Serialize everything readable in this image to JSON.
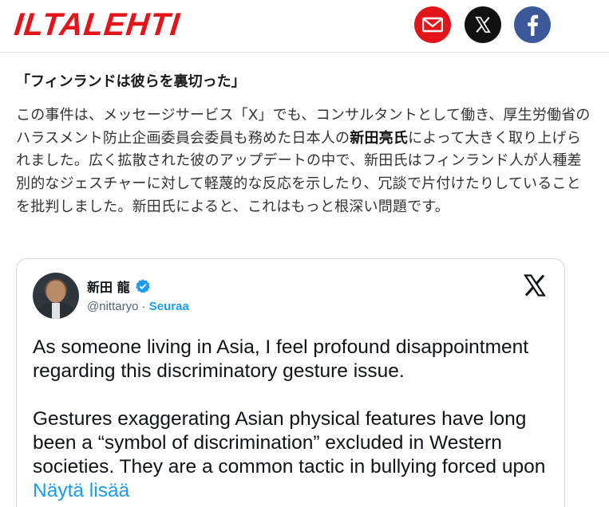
{
  "site": {
    "logo": "ILTALEHTI",
    "share_icons": [
      "email-icon",
      "x-logo-icon",
      "facebook-icon"
    ],
    "colors": {
      "brand_red": "#e4141b",
      "facebook_blue": "#3b5998",
      "link_blue": "#1d9bf0"
    }
  },
  "article": {
    "heading": "「フィンランドは彼らを裏切った」",
    "paragraph_before": "この事件は、メッセージサービス「X」でも、コンサルタントとして働き、厚生労働省のハラスメント防止企画委員会委員も務めた日本人の",
    "paragraph_bold": "新田亮氏",
    "paragraph_after": "によって大きく取り上げられました。広く拡散された彼のアップデートの中で、新田氏はフィンランド人が人種差別的なジェスチャーに対して軽蔑的な反応を示したり、冗談で片付けたりしていることを批判しました。新田氏によると、これはもっと根深い問題です。"
  },
  "tweet": {
    "author_name": "新田 龍",
    "handle": "@nittaryo",
    "separator": " · ",
    "follow_label": "Seuraa",
    "paragraph1": "As someone living in Asia, I feel profound disappointment regarding this discriminatory gesture issue.",
    "paragraph2": "Gestures  exaggerating Asian physical features have long been a “symbol of  discrimination” excluded in Western societies. They are a common tactic  in bullying forced upon ",
    "show_more_label": "Näytä lisää"
  }
}
